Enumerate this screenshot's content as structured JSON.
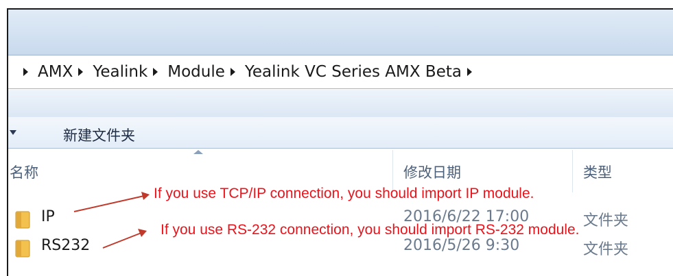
{
  "breadcrumb": {
    "items": [
      "AMX",
      "Yealink",
      "Module",
      "Yealink VC Series AMX Beta"
    ]
  },
  "toolbar": {
    "new_folder_label": "新建文件夹"
  },
  "columns": {
    "name": "名称",
    "date_modified": "修改日期",
    "type": "类型"
  },
  "files": [
    {
      "name": "IP",
      "date": "2016/6/22 17:00",
      "type": "文件夹"
    },
    {
      "name": "RS232",
      "date": "2016/5/26 9:30",
      "type": "文件夹"
    }
  ],
  "annotations": [
    "If you use TCP/IP connection, you should import IP module.",
    "If you use RS-232 connection, you should  import RS-232 module."
  ],
  "colors": {
    "annotation": "#e8141c",
    "arrow": "#c0392b",
    "folder": "#f2c14e"
  }
}
